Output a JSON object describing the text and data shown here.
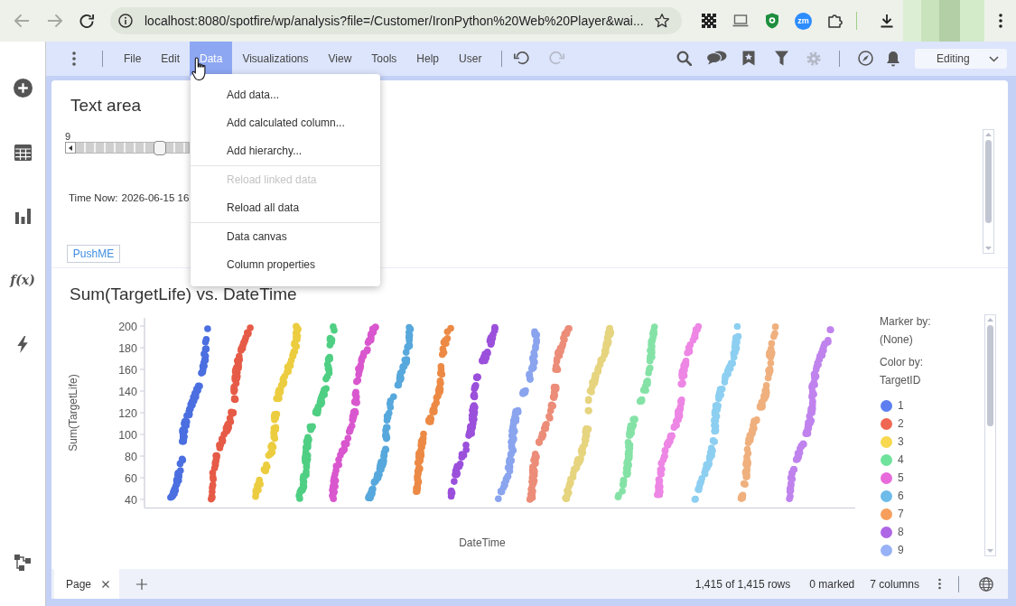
{
  "browser": {
    "nav_buttons": [
      {
        "kind": "back",
        "disabled": true
      },
      {
        "kind": "forward",
        "disabled": true
      },
      {
        "kind": "reload",
        "disabled": false
      }
    ],
    "url": "localhost:8080/spotfire/wp/analysis?file=/Customer/IronPython%20Web%20Player&wai...",
    "extension_label": "zm"
  },
  "sidebar": {
    "expression_label": "f(x)"
  },
  "menu_bar": {
    "items": [
      {
        "label": "File",
        "selected": false
      },
      {
        "label": "Edit",
        "selected": false
      },
      {
        "label": "Data",
        "selected": true
      },
      {
        "label": "Visualizations",
        "selected": false
      },
      {
        "label": "View",
        "selected": false
      },
      {
        "label": "Tools",
        "selected": false
      },
      {
        "label": "Help",
        "selected": false
      },
      {
        "label": "User",
        "selected": false
      }
    ],
    "history_buttons": [
      {
        "kind": "undo",
        "disabled": false
      },
      {
        "kind": "redo",
        "disabled": true
      }
    ],
    "tool_buttons": [
      {
        "kind": "search",
        "disabled": false
      },
      {
        "kind": "comments",
        "disabled": false
      },
      {
        "kind": "bookmarks",
        "disabled": false
      },
      {
        "kind": "filter",
        "disabled": false
      },
      {
        "kind": "settings",
        "disabled": true
      }
    ],
    "panel_buttons": [
      {
        "kind": "navigation",
        "disabled": false
      },
      {
        "kind": "notifications",
        "disabled": false
      }
    ],
    "mode": "Editing"
  },
  "data_menu": {
    "sections": [
      {
        "items": [
          {
            "label": "Add data...",
            "disabled": false
          },
          {
            "label": "Add calculated column...",
            "disabled": false
          },
          {
            "label": "Add hierarchy...",
            "disabled": false
          }
        ]
      },
      {
        "items": [
          {
            "label": "Reload linked data",
            "disabled": true
          },
          {
            "label": "Reload all data",
            "disabled": false
          }
        ]
      },
      {
        "items": [
          {
            "label": "Data canvas",
            "disabled": false
          },
          {
            "label": "Column properties",
            "disabled": false
          }
        ]
      }
    ]
  },
  "text_area": {
    "title": "Text area",
    "slider": {
      "value_label": "9",
      "level": 0.74
    },
    "time_label": "Time Now:",
    "time_value": "2026-06-15 16",
    "button": "PushME"
  },
  "scatter_plot": {
    "title": "Sum(TargetLife) vs. DateTime",
    "y_axis_label": "Sum(TargetLife)",
    "y_ticks": [
      "200",
      "180",
      "160",
      "140",
      "120",
      "100",
      "80",
      "60",
      "40"
    ],
    "x_axis_label": "DateTime",
    "series": [
      {
        "color": "#4b6fe0"
      },
      {
        "color": "#e65b47"
      },
      {
        "color": "#eccd40"
      },
      {
        "color": "#4fcf83"
      },
      {
        "color": "#d957ce"
      },
      {
        "color": "#57a8dc"
      },
      {
        "color": "#ec8a45"
      },
      {
        "color": "#9b50db"
      },
      {
        "color": "#8aa4ee"
      },
      {
        "color": "#ec8d79"
      },
      {
        "color": "#e6d47f"
      },
      {
        "color": "#85e2a6"
      },
      {
        "color": "#ed86e4"
      },
      {
        "color": "#8dcff1"
      },
      {
        "color": "#efb07e"
      },
      {
        "color": "#c083ed"
      }
    ],
    "legend": {
      "marker_by_label": "Marker by:",
      "marker_by": "(None)",
      "color_by_label": "Color by:",
      "color_by": "TargetID",
      "items": [
        {
          "label": "1",
          "color": "#5c7ef0"
        },
        {
          "label": "2",
          "color": "#ef6652"
        },
        {
          "label": "3",
          "color": "#f7d84e"
        },
        {
          "label": "4",
          "color": "#6fe29c"
        },
        {
          "label": "5",
          "color": "#e76bdb"
        },
        {
          "label": "6",
          "color": "#6cbbe9"
        },
        {
          "label": "7",
          "color": "#f69f5c"
        },
        {
          "label": "8",
          "color": "#ae66e5"
        },
        {
          "label": "9",
          "color": "#98b2f7"
        }
      ]
    }
  },
  "status_bar": {
    "page_tabs": [
      {
        "label": "Page",
        "selected": true
      }
    ],
    "rows": "1,415 of 1,415 rows",
    "marked": "0 marked",
    "columns": "7 columns"
  }
}
